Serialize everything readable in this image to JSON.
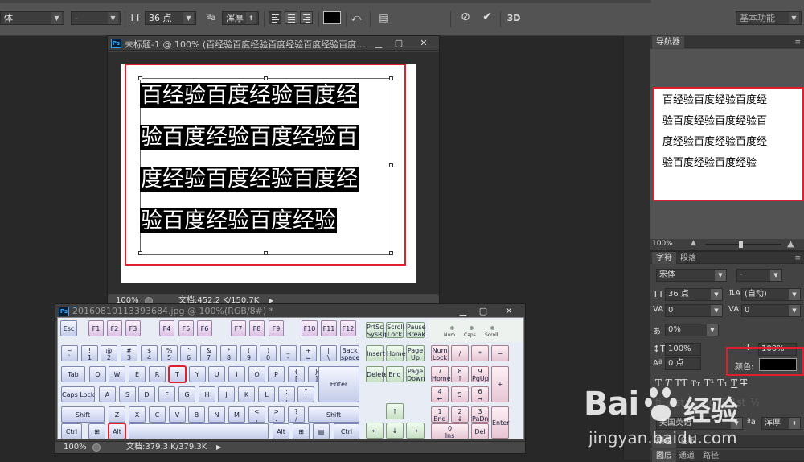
{
  "options_bar": {
    "font_family": "体",
    "font_style": "-",
    "font_size": "36 点",
    "aa_label": "ªa",
    "aa_mode": "浑厚",
    "workspace": "基本功能",
    "size_icon": "text-size-icon",
    "cancel_icon": "cancel-icon",
    "commit_icon": "commit-icon",
    "threed_label": "3D"
  },
  "doc1": {
    "ps_logo": "Ps",
    "title": "未标题-1 @ 100% (百经验百度经验百度经验百度经验百度...",
    "lines": [
      "百经验百度经验百度经",
      "验百度经验百度经验百",
      "度经验百度经验百度经",
      "验百度经验百度经验"
    ],
    "zoom": "100%",
    "doc_info": "文档:452.2 K/150.7K"
  },
  "doc2": {
    "ps_logo": "Ps",
    "title": "20160810113393684.jpg @ 100%(RGB/8#) *",
    "zoom": "100%",
    "doc_info": "文档:379.3 K/379.3K"
  },
  "navigator": {
    "tab": "导航器",
    "lines": [
      "百经验百度经验百度经",
      "验百度经验百度经验百",
      "度经验百度经验百度经",
      "验百度经验百度经验"
    ],
    "zoom": "100%"
  },
  "character": {
    "tabs": [
      "字符",
      "段落"
    ],
    "font_family": "宋体",
    "font_style": "-",
    "font_size": "36 点",
    "leading": "(自动)",
    "kerning": "0",
    "tracking": "0",
    "scale_label": "0%",
    "vscale": "100%",
    "hscale": "100%",
    "baseline": "0 点",
    "color_label": "颜色:",
    "language": "美国英语",
    "aa_label": "ªa",
    "aa_mode": "浑厚",
    "color_tabs": [
      "颜色",
      "色板"
    ],
    "layer_tabs": [
      "图层",
      "通道",
      "路径"
    ]
  },
  "keyboard": {
    "num_led": "Num",
    "caps_led": "Caps",
    "scroll_led": "Scroll",
    "highlight_keys": [
      "T",
      "Alt"
    ]
  },
  "watermark": {
    "brand": "Bai",
    "brand_cn": "经验",
    "url": "jingyan.baidu.com"
  },
  "colors": {
    "highlight_red": "#e01f2e",
    "text_color_swatch": "#000000"
  }
}
